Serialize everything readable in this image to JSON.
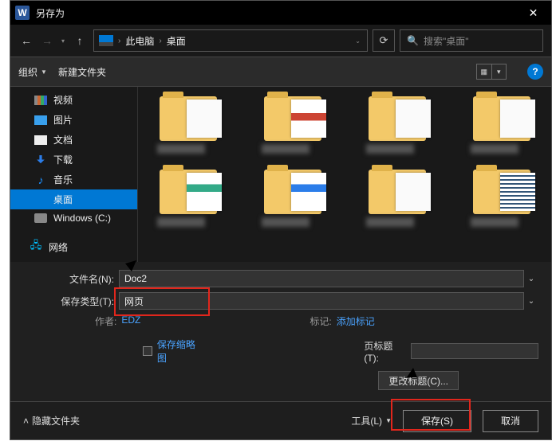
{
  "titlebar": {
    "title": "另存为",
    "app_icon_text": "W"
  },
  "nav": {
    "path_root": "此电脑",
    "path_current": "桌面",
    "refresh_tooltip": "刷新",
    "search_placeholder": "搜索\"桌面\""
  },
  "toolbar": {
    "organize": "组织",
    "new_folder": "新建文件夹"
  },
  "sidebar": {
    "items": [
      {
        "label": "视频",
        "icon": "video-icon"
      },
      {
        "label": "图片",
        "icon": "pictures-icon"
      },
      {
        "label": "文档",
        "icon": "documents-icon"
      },
      {
        "label": "下载",
        "icon": "downloads-icon"
      },
      {
        "label": "音乐",
        "icon": "music-icon"
      },
      {
        "label": "桌面",
        "icon": "desktop-icon",
        "selected": true
      },
      {
        "label": "Windows (C:)",
        "icon": "drive-icon"
      },
      {
        "label": "网络",
        "icon": "network-icon"
      }
    ]
  },
  "form": {
    "filename_label": "文件名(N):",
    "filename_value": "Doc2",
    "filetype_label": "保存类型(T):",
    "filetype_value": "网页",
    "author_label": "作者:",
    "author_value": "EDZ",
    "tags_label": "标记:",
    "tags_value": "添加标记",
    "save_thumb": "保存缩略图",
    "page_title_label": "页标题(T):",
    "page_title_value": "",
    "change_title_btn": "更改标题(C)..."
  },
  "footer": {
    "hide_folders": "隐藏文件夹",
    "tools": "工具(L)",
    "save": "保存(S)",
    "cancel": "取消"
  }
}
